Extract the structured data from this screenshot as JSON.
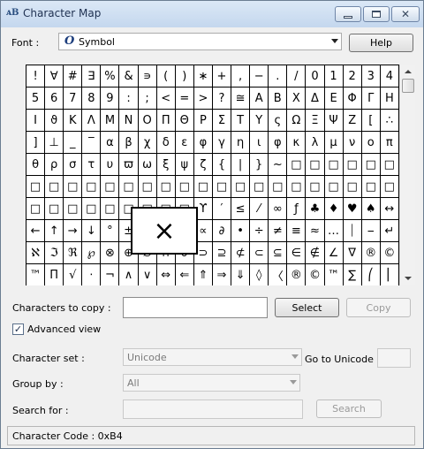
{
  "window": {
    "title": "Character Map",
    "app_icon": "ᴀB",
    "min_icon": "minimize-icon",
    "max_icon": "maximize-icon",
    "close_icon": "close-icon",
    "close_glyph": "✕"
  },
  "font": {
    "label": "Font :",
    "value": "Symbol",
    "icon_glyph": "O",
    "help_label": "Help"
  },
  "grid": {
    "chars": [
      "!",
      "∀",
      "#",
      "∃",
      "%",
      "&",
      "∍",
      "(",
      ")",
      "∗",
      "+",
      ",",
      "−",
      ".",
      "/",
      "0",
      "1",
      "2",
      "3",
      "4",
      "5",
      "6",
      "7",
      "8",
      "9",
      ":",
      ";",
      "<",
      "=",
      ">",
      "?",
      "≅",
      "Α",
      "Β",
      "Χ",
      "Δ",
      "Ε",
      "Φ",
      "Γ",
      "Η",
      "Ι",
      "ϑ",
      "Κ",
      "Λ",
      "Μ",
      "Ν",
      "Ο",
      "Π",
      "Θ",
      "Ρ",
      "Σ",
      "Τ",
      "Υ",
      "ς",
      "Ω",
      "Ξ",
      "Ψ",
      "Ζ",
      "[",
      "∴",
      "]",
      "⊥",
      "_",
      "‾",
      "α",
      "β",
      "χ",
      "δ",
      "ε",
      "φ",
      "γ",
      "η",
      "ι",
      "φ",
      "κ",
      "λ",
      "μ",
      "ν",
      "ο",
      "π",
      "θ",
      "ρ",
      "σ",
      "τ",
      "υ",
      "ϖ",
      "ω",
      "ξ",
      "ψ",
      "ζ",
      "{",
      "|",
      "}",
      "~",
      "□",
      "□",
      "□",
      "□",
      "□",
      "□",
      "□",
      "□",
      "□",
      "□",
      "□",
      "□",
      "□",
      "□",
      "□",
      "□",
      "□",
      "□",
      "□",
      "□",
      "□",
      "□",
      "□",
      "□",
      "□",
      "□",
      "□",
      "□",
      "□",
      "□",
      "□",
      "□",
      "□",
      "□",
      "□",
      "ϒ",
      "′",
      "≤",
      "⁄",
      "∞",
      "ƒ",
      "♣",
      "♦",
      "♥",
      "♠",
      "↔",
      "←",
      "↑",
      "→",
      "↓",
      "°",
      "±",
      "″",
      "≥",
      "×",
      "∝",
      "∂",
      "•",
      "÷",
      "≠",
      "≡",
      "≈",
      "…",
      "⏐",
      "⎯",
      "↵",
      "ℵ",
      "ℑ",
      "ℜ",
      "℘",
      "⊗",
      "⊕",
      "∅",
      "∩",
      "∪",
      "⊃",
      "⊇",
      "⊄",
      "⊂",
      "⊆",
      "∈",
      "∉",
      "∠",
      "∇",
      "®",
      "©",
      "™",
      "Π",
      "√",
      "⋅",
      "¬",
      "∧",
      "∨",
      "⇔",
      "⇐",
      "⇑",
      "⇒",
      "⇓",
      "◊",
      "〈",
      "®",
      "©",
      "™",
      "∑",
      "⎛",
      "⎜",
      "⎝"
    ],
    "magnified_char": "×"
  },
  "copy": {
    "label": "Characters to copy :",
    "value": "",
    "select_label": "Select",
    "copy_label": "Copy"
  },
  "advanced": {
    "checked": true,
    "check_glyph": "✓",
    "label": "Advanced view"
  },
  "charset": {
    "label": "Character set :",
    "value": "Unicode",
    "goto_label": "Go to Unicode :"
  },
  "group": {
    "label": "Group by :",
    "value": "All"
  },
  "search": {
    "label": "Search for :",
    "value": "",
    "button_label": "Search"
  },
  "status": {
    "text": "Character Code : 0xB4"
  }
}
